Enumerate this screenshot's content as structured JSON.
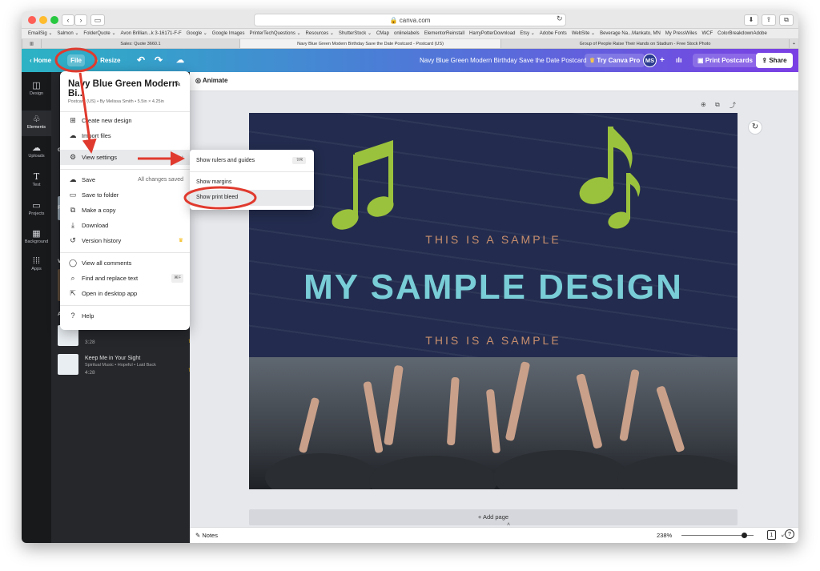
{
  "browser": {
    "url": "canva.com",
    "bookmarks": [
      "EmailSig ⌄",
      "Salmon ⌄",
      "FolderQuote ⌄",
      "Avon Brillian...k 3-16171-F-F",
      "Google ⌄",
      "Google Images",
      "PrinterTechQuestions ⌄",
      "Resources ⌄",
      "ShutterStock ⌄",
      "CMap",
      "onlinelabels",
      "ElementorReinstall",
      "HarryPotterDownload",
      "Etsy ⌄",
      "Adobe Fonts",
      "WebSite ⌄",
      "Beverage Na...Mankato, MN",
      "My PressWiles",
      "WCF",
      "ColorBreakdownAdobe"
    ],
    "tabs": [
      "Sales: Quote 3660.1",
      "Navy Blue Green Modern Birthday Save the Date Postcard - Postcard (US)",
      "Group of People Raise Their Hands on Stadium - Free Stock Photo"
    ]
  },
  "header": {
    "home": "Home",
    "file": "File",
    "resize": "Resize",
    "doc_title": "Navy Blue Green Modern Birthday Save the Date Postcard",
    "try_pro": "Try Canva Pro",
    "avatar": "MS",
    "print": "Print Postcards",
    "share": "Share"
  },
  "leftbar": {
    "items": [
      {
        "label": "Design",
        "icon": "layout-icon"
      },
      {
        "label": "Elements",
        "icon": "shapes-icon"
      },
      {
        "label": "Uploads",
        "icon": "cloud-upload-icon"
      },
      {
        "label": "Text",
        "icon": "text-icon"
      },
      {
        "label": "Projects",
        "icon": "folder-icon"
      },
      {
        "label": "Background",
        "icon": "pattern-icon"
      },
      {
        "label": "Apps",
        "icon": "grid-icon"
      }
    ]
  },
  "panel": {
    "fragments": [
      "Gr",
      "Ph",
      "Vi",
      "Au"
    ],
    "tracks": [
      {
        "duration": "3:28"
      },
      {
        "title": "Keep Me in Your Sight",
        "meta": "Spiritual Music • Hopeful • Laid Back",
        "duration": "4:28"
      }
    ]
  },
  "file_menu": {
    "title": "Navy Blue Green Modern Bi...",
    "subtitle": "Postcard (US) • By Melissa Smith • 5.5in × 4.25in",
    "items": [
      {
        "label": "Create new design",
        "icon": "plus-square-icon"
      },
      {
        "label": "Import files",
        "icon": "cloud-upload-icon"
      },
      {
        "label": "View settings",
        "icon": "gear-icon",
        "right": "›"
      },
      {
        "label": "Save",
        "icon": "cloud-check-icon",
        "right": "All changes saved"
      },
      {
        "label": "Save to folder",
        "icon": "folder-icon"
      },
      {
        "label": "Make a copy",
        "icon": "copy-icon"
      },
      {
        "label": "Download",
        "icon": "download-icon"
      },
      {
        "label": "Version history",
        "icon": "history-icon",
        "right": "♛"
      },
      {
        "label": "View all comments",
        "icon": "comment-icon"
      },
      {
        "label": "Find and replace text",
        "icon": "search-icon",
        "right": "⌘F"
      },
      {
        "label": "Open in desktop app",
        "icon": "external-icon"
      },
      {
        "label": "Help",
        "icon": "help-icon"
      }
    ]
  },
  "view_submenu": {
    "items": [
      {
        "label": "Show rulers and guides",
        "shortcut": "⇧R"
      },
      {
        "label": "Show margins"
      },
      {
        "label": "Show print bleed"
      }
    ]
  },
  "editor": {
    "animate": "Animate",
    "add_page": "+ Add page",
    "notes": "Notes",
    "zoom": "238%",
    "page_num": "1",
    "help": "?"
  },
  "design": {
    "line1": "THIS IS A SAMPLE",
    "title": "MY SAMPLE DESIGN",
    "line2": "THIS IS A SAMPLE",
    "colors": {
      "background": "#232c4e",
      "title": "#79cdd6",
      "accent_text": "#c98f6e",
      "note": "#9bc23c"
    }
  },
  "annotations": {
    "color": "#e03a2e"
  }
}
